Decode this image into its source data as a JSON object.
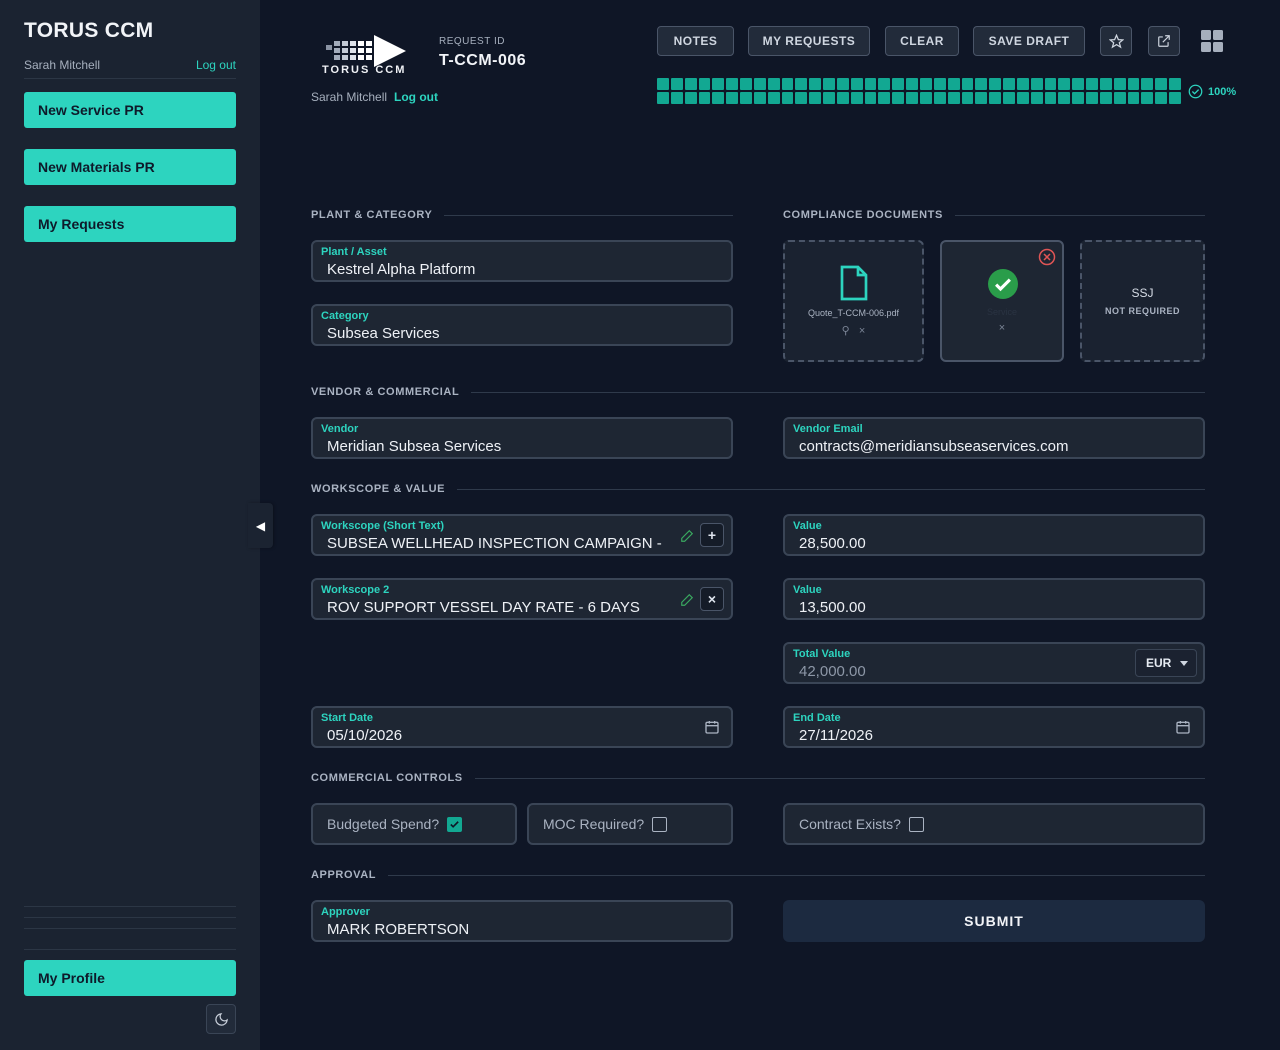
{
  "sidebar": {
    "title": "TORUS CCM",
    "user": "Sarah Mitchell",
    "logout": "Log out",
    "nav": [
      "New Service PR",
      "New Materials PR",
      "My Requests"
    ],
    "profile": "My Profile"
  },
  "header": {
    "logo_text": "TORUS CCM",
    "user": "Sarah Mitchell",
    "logout": "Log out",
    "request_id_label": "REQUEST ID",
    "request_id": "T-CCM-006",
    "buttons": {
      "notes": "NOTES",
      "my_requests": "MY REQUESTS",
      "clear": "CLEAR",
      "save_draft": "SAVE DRAFT"
    },
    "progress_pct": "100%",
    "progress_value": 1.0
  },
  "sections": {
    "plant": "PLANT & CATEGORY",
    "compliance": "COMPLIANCE DOCUMENTS",
    "vendor": "VENDOR & COMMERCIAL",
    "workscope": "WORKSCOPE & VALUE",
    "controls": "COMMERCIAL CONTROLS",
    "approval": "APPROVAL"
  },
  "fields": {
    "plant": {
      "label": "Plant / Asset",
      "value": "Kestrel Alpha Platform"
    },
    "category": {
      "label": "Category",
      "value": "Subsea Services"
    },
    "vendor": {
      "label": "Vendor",
      "value": "Meridian Subsea Services"
    },
    "vendor_email": {
      "label": "Vendor Email",
      "value": "contracts@meridiansubseaservices.com"
    },
    "workscope1": {
      "label": "Workscope (Short Text)",
      "value": "SUBSEA WELLHEAD INSPECTION CAMPAIGN - PHA"
    },
    "value1": {
      "label": "Value",
      "value": "28,500.00"
    },
    "workscope2": {
      "label": "Workscope 2",
      "value": "ROV SUPPORT VESSEL DAY RATE - 6 DAYS"
    },
    "value2": {
      "label": "Value",
      "value": "13,500.00"
    },
    "total": {
      "label": "Total Value",
      "value": "42,000.00",
      "currency": "EUR"
    },
    "start_date": {
      "label": "Start Date",
      "value": "05/10/2026"
    },
    "end_date": {
      "label": "End Date",
      "value": "27/11/2026"
    },
    "approver": {
      "label": "Approver",
      "value": "MARK ROBERTSON"
    }
  },
  "compliance_docs": {
    "quote_file": "Quote_T-CCM-006.pdf",
    "service_label": "Service",
    "ssj_title": "SSJ",
    "ssj_note": "NOT REQUIRED"
  },
  "controls": {
    "budgeted": {
      "label": "Budgeted Spend?",
      "checked": true
    },
    "moc": {
      "label": "MOC Required?",
      "checked": false
    },
    "contract": {
      "label": "Contract Exists?",
      "checked": false
    }
  },
  "submit": "SUBMIT",
  "colors": {
    "accent": "#2dd4bf",
    "progress": "#12a892",
    "background": "#0f1626",
    "sidebar": "#1b2331"
  }
}
